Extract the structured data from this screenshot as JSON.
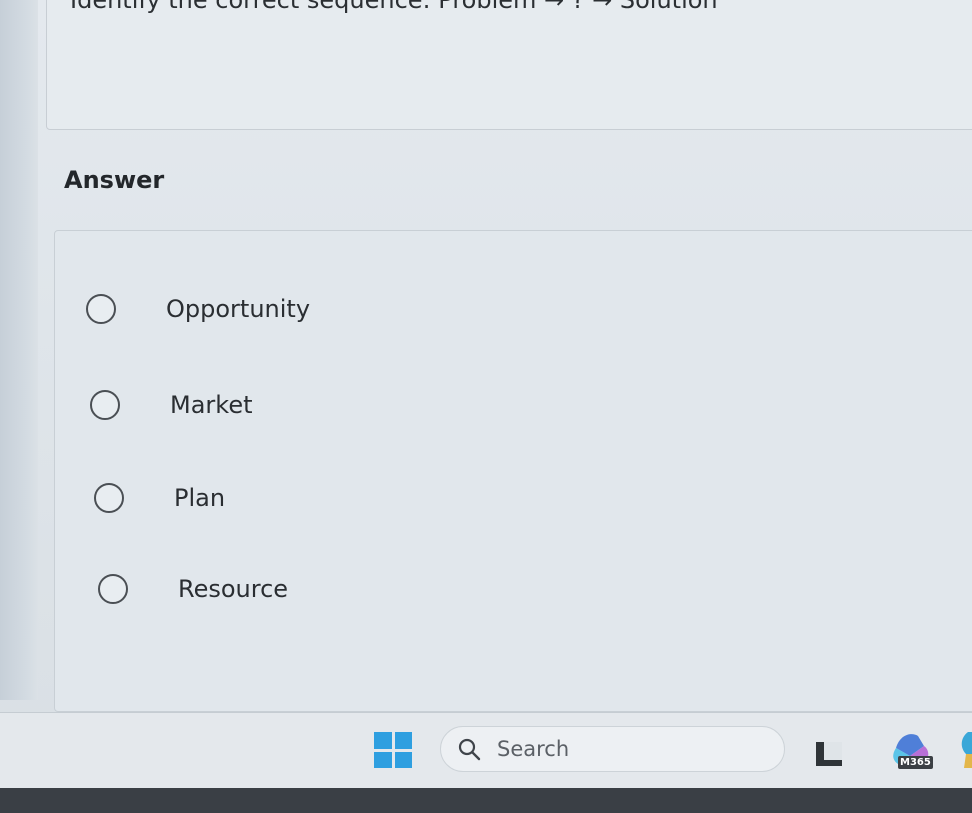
{
  "question": {
    "text": "Identify the correct sequence: Problem → ? → Solution"
  },
  "answer": {
    "heading": "Answer",
    "options": [
      {
        "label": "Opportunity"
      },
      {
        "label": "Market"
      },
      {
        "label": "Plan"
      },
      {
        "label": "Resource"
      }
    ]
  },
  "taskbar": {
    "start_icon": "windows-logo-icon",
    "search_placeholder": "Search",
    "search_icon": "search-icon",
    "m365_badge": "M365",
    "accent_color": "#2e9fe0"
  }
}
